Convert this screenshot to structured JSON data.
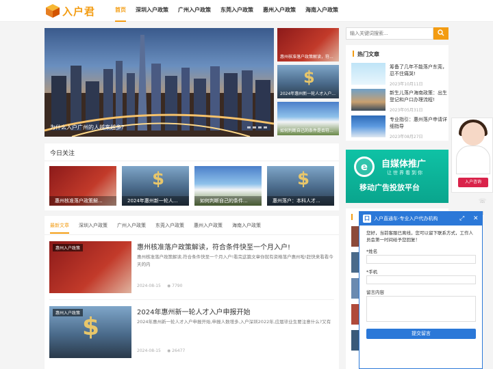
{
  "header": {
    "logo_text": "入户君",
    "nav": [
      "首页",
      "深圳入户政策",
      "广州入户政策",
      "东莞入户政策",
      "惠州入户政策",
      "海南入户政策"
    ]
  },
  "banner": {
    "caption": "为什么入户广州的人越来越多?",
    "side": [
      {
        "caption": "惠州核准落户政策解读，符..."
      },
      {
        "caption": "2024年惠州新一轮人才入户..."
      },
      {
        "caption": "如何判断自己的条件是否符..."
      }
    ]
  },
  "search": {
    "placeholder": "输入关键词搜索..."
  },
  "hot": {
    "title": "热门文章",
    "items": [
      {
        "title": "筹备了几年不能落户东莞，忍不住痛哭!",
        "date": "2023年10月11日"
      },
      {
        "title": "新生儿落户海南政策：出生登记和户口办理流程!",
        "date": "2023年05月31日"
      },
      {
        "title": "专业指引：惠州落户申请详细指导",
        "date": "2023年08月27日"
      }
    ]
  },
  "ad": {
    "title": "自媒体推广",
    "subtitle": "让世界看到你",
    "main": "移动广告投放平台",
    "logo": "e"
  },
  "today": {
    "title": "今日关注",
    "cards": [
      "惠州核准落户政策解...",
      "2024年惠州新一轮人...",
      "如何判断自己的条件...",
      "惠州落户：本科人才..."
    ]
  },
  "news": {
    "tabs": [
      "最新文章",
      "深圳入户政策",
      "广州入户政策",
      "东莞入户政策",
      "惠州入户政策",
      "海南入户政策"
    ],
    "articles": [
      {
        "tag": "惠州入户政策",
        "title": "惠州核准落户政策解读，符合条件快至一个月入户!",
        "summary": "惠州核准落户政策解读,符合条件快至一个月入户!看完这篇文章你就有资格落户惠州啦!赶快来看看今天的内",
        "date": "2024-08-15",
        "views": "7790"
      },
      {
        "tag": "惠州入户政策",
        "title": "2024年惠州新一轮人才入户申报开始",
        "summary": "2024年惠州新一轮人才入户申报开始,申报人数增多,入户深圳2022年,应届毕业生要注意什么?又有",
        "date": "2024-08-15",
        "views": "26477"
      }
    ]
  },
  "agent": {
    "button": "入户咨询"
  },
  "chat": {
    "title": "入户直通车-专业入户代办机构",
    "message": "您好，当前客服已离线，您可以留下联系方式，工作人员会第一时间给予您回复！",
    "name_label": "*姓名",
    "phone_label": "*手机",
    "content_label": "留言内容",
    "submit": "提交留言",
    "logo": "口"
  },
  "colors": {
    "accent": "#f39c12",
    "chat_blue": "#2b78d8",
    "ad_green": "#0fc2a5"
  }
}
